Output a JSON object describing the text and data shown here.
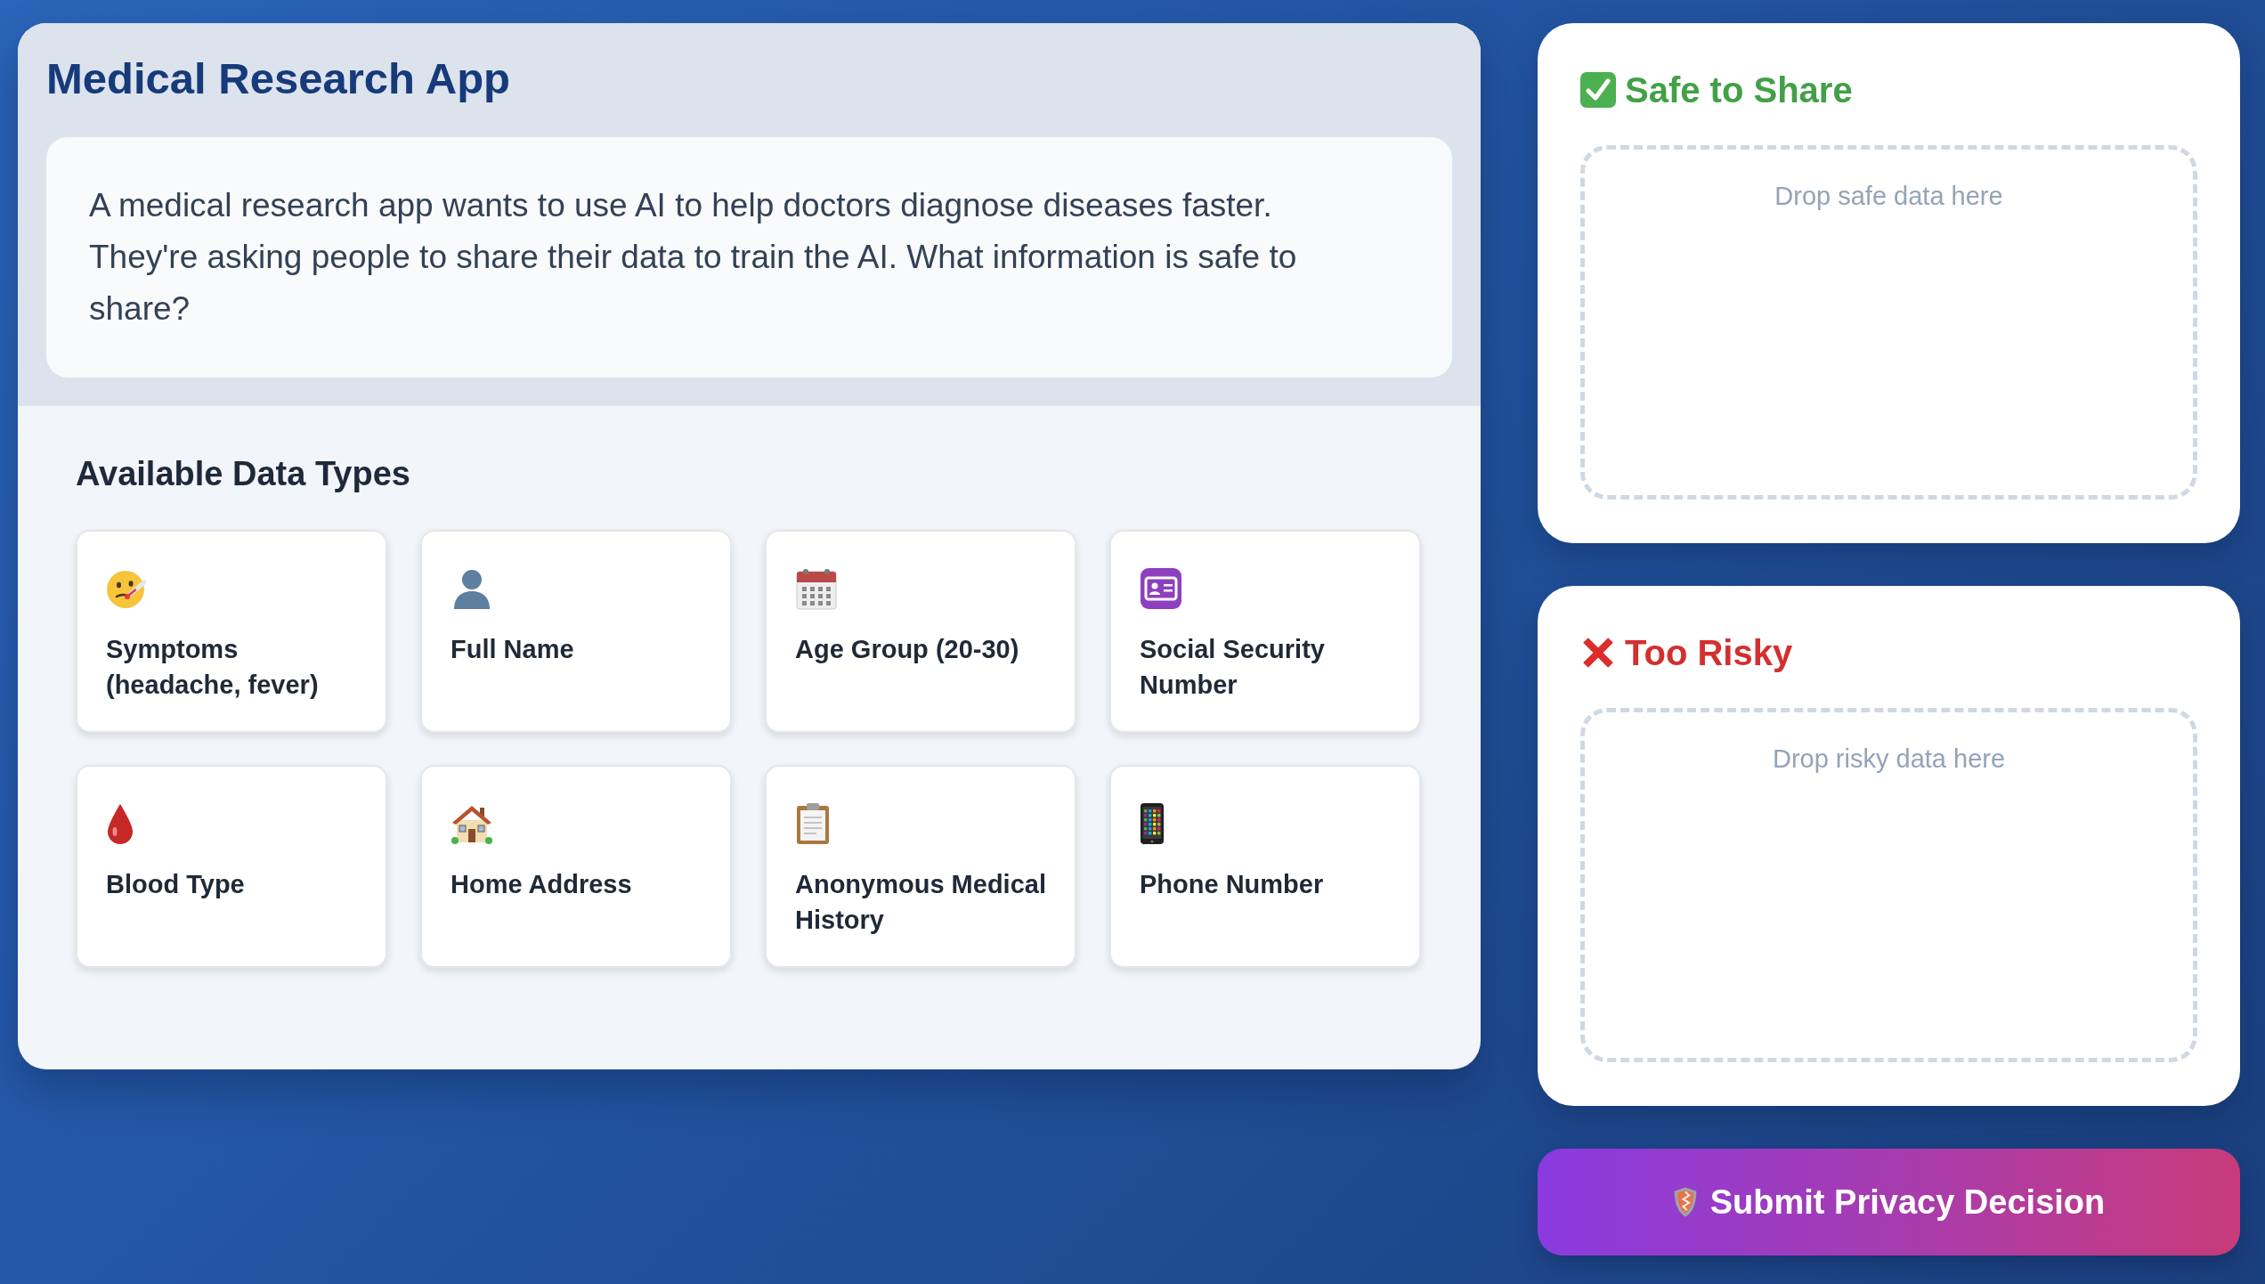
{
  "app": {
    "title": "Medical Research App",
    "scenario": "A medical research app wants to use AI to help doctors diagnose diseases faster. They're asking people to share their data to train the AI. What information is safe to share?"
  },
  "data_types": {
    "heading": "Available Data Types",
    "items": [
      {
        "label": "Symptoms (headache, fever)"
      },
      {
        "label": "Full Name"
      },
      {
        "label": "Age Group (20-30)"
      },
      {
        "label": "Social Security Number"
      },
      {
        "label": "Blood Type"
      },
      {
        "label": "Home Address"
      },
      {
        "label": "Anonymous Medical History"
      },
      {
        "label": "Phone Number"
      }
    ]
  },
  "zones": [
    {
      "kind": "safe",
      "title": "Safe to Share",
      "drop_hint": "Drop safe data here"
    },
    {
      "kind": "risky",
      "title": "Too Risky",
      "drop_hint": "Drop risky data here"
    }
  ],
  "submit_button": {
    "label": "Submit Privacy Decision"
  }
}
